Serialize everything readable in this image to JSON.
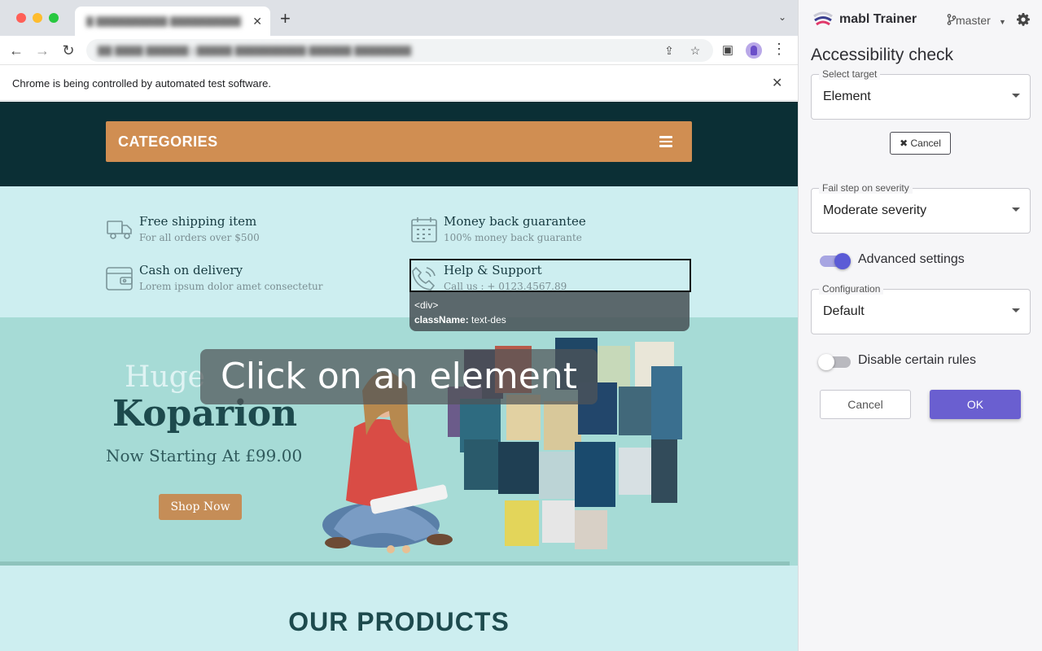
{
  "browser": {
    "tab_title": "▓ ▓▓▓▓▓▓▓▓▓▓ ▓▓▓▓▓▓▓▓▓▓ ▓▓▓▓",
    "tab_close": "✕",
    "new_tab": "+",
    "url": "▓▓ ▓▓▓▓ ▓▓▓▓▓▓ | ▓▓▓▓▓ ▓▓▓▓▓▓▓▓▓▓ ▓▓▓▓▓▓ ▓▓▓▓▓▓▓▓",
    "infobar_text": "Chrome is being controlled by automated test software.",
    "infobar_close": "✕",
    "icons": [
      "back-icon",
      "forward-icon",
      "reload-icon",
      "share-icon",
      "bookmark-star-icon",
      "side-panel-icon",
      "profile-avatar",
      "menu-icon"
    ]
  },
  "site": {
    "categories_label": "CATEGORIES",
    "features": [
      {
        "icon": "truck-icon",
        "title": "Free shipping item",
        "subtitle": "For all orders over $500"
      },
      {
        "icon": "calendar-icon",
        "title": "Money back guarantee",
        "subtitle": "100% money back guarante"
      },
      {
        "icon": "wallet-icon",
        "title": "Cash on delivery",
        "subtitle": "Lorem ipsum dolor amet consectetur"
      },
      {
        "icon": "phone-icon",
        "title": "Help & Support",
        "subtitle": "Call us : + 0123.4567.89"
      }
    ],
    "tooltip": {
      "tag": "<div>",
      "class_key": "className:",
      "class_value": " text-des"
    },
    "hero": {
      "small_text": "Huge",
      "title": "Koparion",
      "subtitle": "Now Starting At £99.00",
      "button": "Shop Now"
    },
    "overlay_text": "Click on an element",
    "products_title": "OUR PRODUCTS"
  },
  "panel": {
    "brand": "mabl Trainer",
    "branch": "master",
    "title": "Accessibility check",
    "select_target": {
      "label": "Select target",
      "value": "Element"
    },
    "cancel_small": "✖ Cancel",
    "fail_severity": {
      "label": "Fail step on severity",
      "value": "Moderate severity"
    },
    "advanced_settings": {
      "label": "Advanced settings",
      "enabled": true
    },
    "configuration": {
      "label": "Configuration",
      "value": "Default"
    },
    "disable_rules": {
      "label": "Disable certain rules",
      "enabled": false
    },
    "cancel": "Cancel",
    "ok": "OK",
    "colors": {
      "accent": "#6a5fd0",
      "toggle_on": "#5b5bd6"
    }
  }
}
